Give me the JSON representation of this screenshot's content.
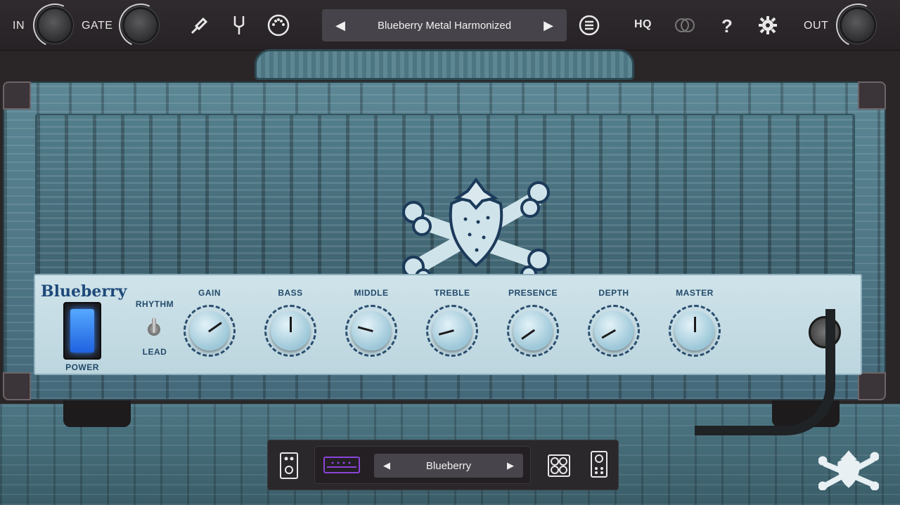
{
  "topbar": {
    "in_label": "IN",
    "gate_label": "GATE",
    "preset_name": "Blueberry Metal Harmonized",
    "hq_label": "HQ",
    "help_label": "?",
    "out_label": "OUT",
    "icons": [
      "guitar-cable-icon",
      "tuning-fork-icon",
      "midi-icon",
      "preset-list-icon",
      "stereo-link-icon",
      "gear-icon"
    ]
  },
  "amp": {
    "brand": "Blueberry",
    "power_label": "POWER",
    "rhythm_label": "RHYTHM",
    "lead_label": "LEAD",
    "knobs": [
      {
        "label": "GAIN",
        "rotation": 55
      },
      {
        "label": "BASS",
        "rotation": 0
      },
      {
        "label": "MIDDLE",
        "rotation": -75
      },
      {
        "label": "TREBLE",
        "rotation": -105
      },
      {
        "label": "PRESENCE",
        "rotation": -125
      },
      {
        "label": "DEPTH",
        "rotation": -120
      },
      {
        "label": "MASTER",
        "rotation": 0
      }
    ],
    "colors": {
      "panel": "#c6dde5",
      "label": "#234a6a",
      "power_light": "#3a8bff"
    }
  },
  "bottombar": {
    "cab_name": "Blueberry",
    "icons": [
      "pedalboard-icon",
      "amp-head-icon",
      "cabinet-4x-icon",
      "cabinet-vertical-icon"
    ],
    "accent": "#8a44d8"
  }
}
